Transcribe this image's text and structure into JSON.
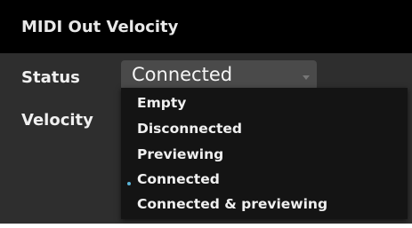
{
  "panel": {
    "title": "MIDI Out Velocity",
    "status_label": "Status",
    "velocity_label": "Velocity",
    "status_select": {
      "value": "Connected",
      "options": [
        "Empty",
        "Disconnected",
        "Previewing",
        "Connected",
        "Connected & previewing"
      ],
      "selected_index": 3
    }
  },
  "colors": {
    "header_bg": "#000000",
    "panel_bg": "#2e2e2e",
    "dropdown_bg": "#141414",
    "selected_bullet": "#5ab4d8"
  }
}
